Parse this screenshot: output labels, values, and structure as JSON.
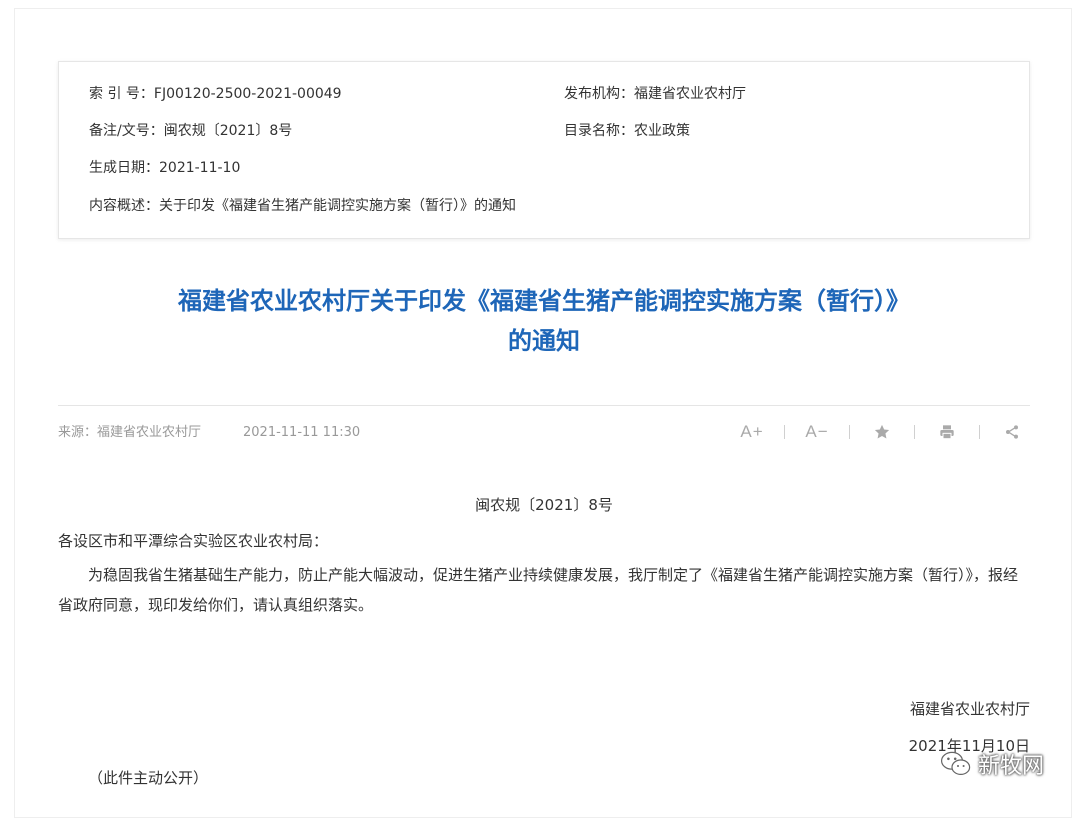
{
  "meta": {
    "index_label": "索 引 号：",
    "index_value": "FJ00120-2500-2021-00049",
    "publisher_label": "发布机构：",
    "publisher_value": "福建省农业农村厅",
    "doc_label": "备注/文号：",
    "doc_value": "闽农规〔2021〕8号",
    "catalog_label": "目录名称：",
    "catalog_value": "农业政策",
    "date_label": "生成日期：",
    "date_value": "2021-11-10",
    "summary_label": "内容概述：",
    "summary_value": "关于印发《福建省生猪产能调控实施方案（暂行）》的通知"
  },
  "article": {
    "title_line1": "福建省农业农村厅关于印发《福建省生猪产能调控实施方案（暂行）》",
    "title_line2": "的通知",
    "source_label": "来源：",
    "source_value": "福建省农业农村厅",
    "publish_time": "2021-11-11 11:30",
    "doc_number": "闽农规〔2021〕8号",
    "salutation": "各设区市和平潭综合实验区农业农村局：",
    "paragraph": "为稳固我省生猪基础生产能力，防止产能大幅波动，促进生猪产业持续健康发展，我厅制定了《福建省生猪产能调控实施方案（暂行）》，报经省政府同意，现印发给你们，请认真组织落实。",
    "signature": "福建省农业农村厅",
    "sign_date": "2021年11月10日",
    "disclosure": "（此件主动公开）"
  },
  "toolbar": {
    "font_increase": "A+",
    "font_decrease": "A−",
    "icons": [
      "font-increase-icon",
      "font-decrease-icon",
      "star-icon",
      "print-icon",
      "share-icon"
    ]
  },
  "watermark": {
    "text": "新牧网",
    "icon": "wechat-icon"
  },
  "colors": {
    "title": "#1e66b8",
    "muted": "#999999",
    "text": "#333333"
  }
}
